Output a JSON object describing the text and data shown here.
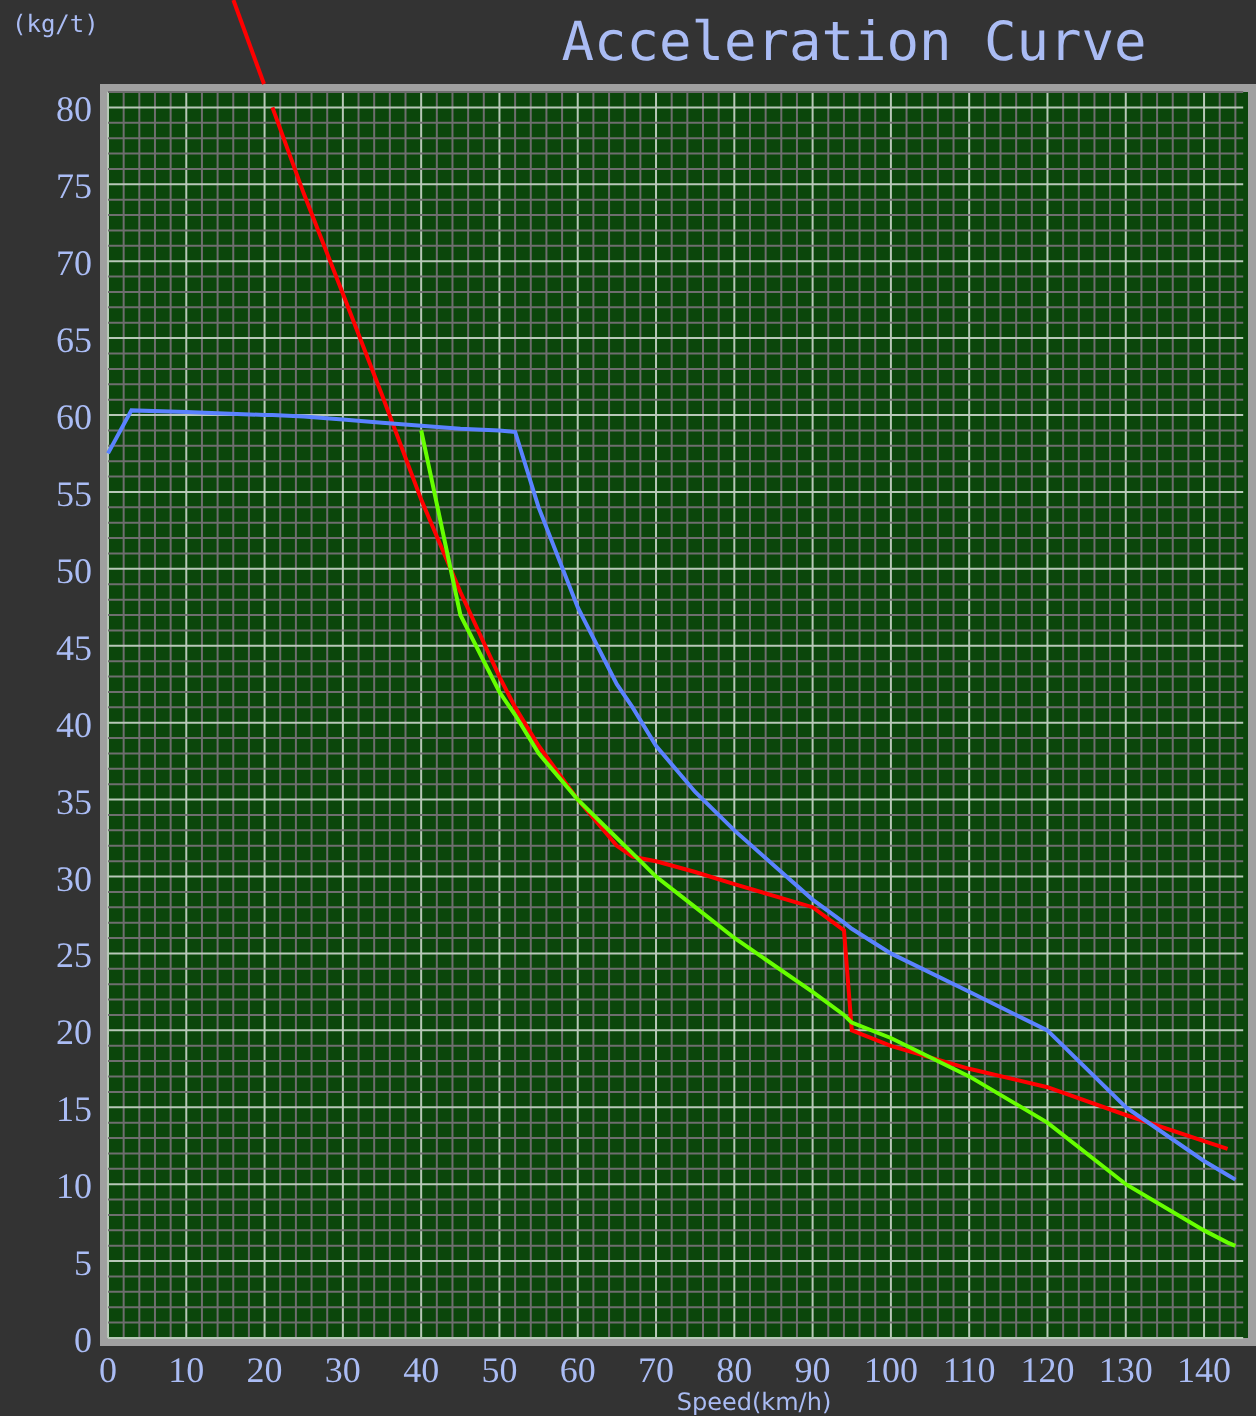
{
  "chart": {
    "unit_label": "(kg/t)",
    "chart_data": {
      "type": "line",
      "title": "Acceleration Curve",
      "xlabel": "Speed(km/h)",
      "x": [
        0,
        3,
        10,
        20,
        21,
        25,
        30,
        35,
        40,
        45,
        50,
        52,
        55,
        60,
        65,
        67,
        70,
        75,
        80,
        90,
        94,
        95,
        100,
        110,
        120,
        130,
        140,
        143,
        144
      ],
      "series": [
        {
          "color": "#ff0000",
          "values": [
            null,
            null,
            null,
            null,
            80,
            74.4,
            67.9,
            61.3,
            54.5,
            48.5,
            43,
            41,
            38.5,
            35,
            32,
            31.3,
            31,
            30.3,
            29.5,
            28,
            26.5,
            20,
            19,
            17.5,
            16.3,
            14.5,
            12.8,
            12.3,
            null
          ]
        },
        {
          "color": "#5a82ff",
          "values": [
            57.5,
            60.3,
            60.2,
            60,
            60,
            59.9,
            59.7,
            59.5,
            59.3,
            59.1,
            59,
            58.9,
            54,
            47.5,
            42.5,
            41,
            38.5,
            35.5,
            33,
            28.5,
            27,
            26.6,
            25,
            22.5,
            20,
            15,
            11.5,
            10.6,
            10.3
          ]
        },
        {
          "color": "#66ff00",
          "values": [
            null,
            null,
            null,
            null,
            null,
            null,
            null,
            null,
            59,
            47,
            42,
            40.5,
            38,
            35,
            32.5,
            31.5,
            30,
            28,
            26,
            22.5,
            21,
            20.5,
            19.5,
            17,
            14,
            10,
            7,
            6.2,
            6
          ]
        }
      ],
      "grid": true,
      "xlim": [
        0,
        145
      ],
      "ylim": [
        0,
        81
      ],
      "xticks": [
        0,
        10,
        20,
        30,
        40,
        50,
        60,
        70,
        80,
        90,
        100,
        110,
        120,
        130,
        140
      ],
      "yticks": [
        0,
        5,
        10,
        15,
        20,
        25,
        30,
        35,
        40,
        45,
        50,
        55,
        60,
        65,
        70,
        75,
        80
      ]
    }
  }
}
